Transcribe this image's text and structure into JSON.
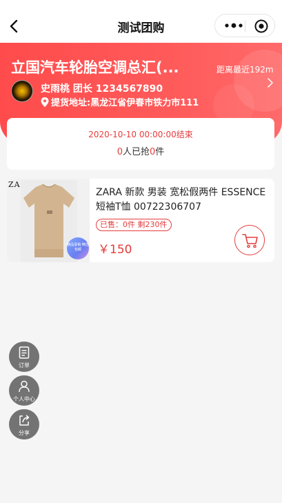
{
  "nav": {
    "title": "测试团购"
  },
  "store": {
    "name": "立国汽车轮胎空调总汇(...",
    "distance": "距离最近192m",
    "leader": "史雨桃 团长 1234567890",
    "address": "提货地址:黑龙江省伊春市铁力市111"
  },
  "deal": {
    "end_time": "2020-10-10 00:00:00结束",
    "grab_count": "0",
    "grab_mid": "人已抢",
    "grab_items": "0",
    "grab_unit": "件"
  },
  "product": {
    "brand_mark": "ZARA",
    "title": "ZARA 新款 男装 宽松假两件 ESSENCE短袖T恤 00722306707",
    "sold_label": "已售：0件  剩230件",
    "price": "￥150",
    "badge_text": "精品促销 精选包邮"
  },
  "float_buttons": [
    {
      "label": "订单",
      "icon": "order-icon"
    },
    {
      "label": "个人中心",
      "icon": "user-icon"
    },
    {
      "label": "分享",
      "icon": "share-icon"
    }
  ],
  "colors": {
    "accent": "#e53b3b",
    "hero": "#ff5252",
    "float_bg": "#737373"
  }
}
